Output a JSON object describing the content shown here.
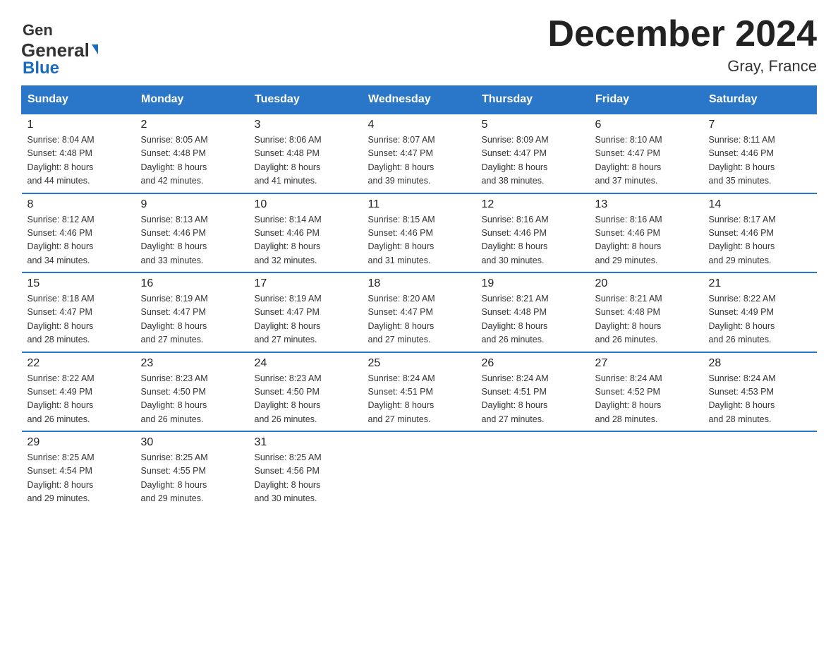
{
  "header": {
    "logo_general": "General",
    "logo_blue": "Blue",
    "title": "December 2024",
    "subtitle": "Gray, France"
  },
  "days_of_week": [
    "Sunday",
    "Monday",
    "Tuesday",
    "Wednesday",
    "Thursday",
    "Friday",
    "Saturday"
  ],
  "weeks": [
    [
      {
        "day": "1",
        "sunrise": "8:04 AM",
        "sunset": "4:48 PM",
        "daylight_hours": "8 hours",
        "daylight_minutes": "and 44 minutes."
      },
      {
        "day": "2",
        "sunrise": "8:05 AM",
        "sunset": "4:48 PM",
        "daylight_hours": "8 hours",
        "daylight_minutes": "and 42 minutes."
      },
      {
        "day": "3",
        "sunrise": "8:06 AM",
        "sunset": "4:48 PM",
        "daylight_hours": "8 hours",
        "daylight_minutes": "and 41 minutes."
      },
      {
        "day": "4",
        "sunrise": "8:07 AM",
        "sunset": "4:47 PM",
        "daylight_hours": "8 hours",
        "daylight_minutes": "and 39 minutes."
      },
      {
        "day": "5",
        "sunrise": "8:09 AM",
        "sunset": "4:47 PM",
        "daylight_hours": "8 hours",
        "daylight_minutes": "and 38 minutes."
      },
      {
        "day": "6",
        "sunrise": "8:10 AM",
        "sunset": "4:47 PM",
        "daylight_hours": "8 hours",
        "daylight_minutes": "and 37 minutes."
      },
      {
        "day": "7",
        "sunrise": "8:11 AM",
        "sunset": "4:46 PM",
        "daylight_hours": "8 hours",
        "daylight_minutes": "and 35 minutes."
      }
    ],
    [
      {
        "day": "8",
        "sunrise": "8:12 AM",
        "sunset": "4:46 PM",
        "daylight_hours": "8 hours",
        "daylight_minutes": "and 34 minutes."
      },
      {
        "day": "9",
        "sunrise": "8:13 AM",
        "sunset": "4:46 PM",
        "daylight_hours": "8 hours",
        "daylight_minutes": "and 33 minutes."
      },
      {
        "day": "10",
        "sunrise": "8:14 AM",
        "sunset": "4:46 PM",
        "daylight_hours": "8 hours",
        "daylight_minutes": "and 32 minutes."
      },
      {
        "day": "11",
        "sunrise": "8:15 AM",
        "sunset": "4:46 PM",
        "daylight_hours": "8 hours",
        "daylight_minutes": "and 31 minutes."
      },
      {
        "day": "12",
        "sunrise": "8:16 AM",
        "sunset": "4:46 PM",
        "daylight_hours": "8 hours",
        "daylight_minutes": "and 30 minutes."
      },
      {
        "day": "13",
        "sunrise": "8:16 AM",
        "sunset": "4:46 PM",
        "daylight_hours": "8 hours",
        "daylight_minutes": "and 29 minutes."
      },
      {
        "day": "14",
        "sunrise": "8:17 AM",
        "sunset": "4:46 PM",
        "daylight_hours": "8 hours",
        "daylight_minutes": "and 29 minutes."
      }
    ],
    [
      {
        "day": "15",
        "sunrise": "8:18 AM",
        "sunset": "4:47 PM",
        "daylight_hours": "8 hours",
        "daylight_minutes": "and 28 minutes."
      },
      {
        "day": "16",
        "sunrise": "8:19 AM",
        "sunset": "4:47 PM",
        "daylight_hours": "8 hours",
        "daylight_minutes": "and 27 minutes."
      },
      {
        "day": "17",
        "sunrise": "8:19 AM",
        "sunset": "4:47 PM",
        "daylight_hours": "8 hours",
        "daylight_minutes": "and 27 minutes."
      },
      {
        "day": "18",
        "sunrise": "8:20 AM",
        "sunset": "4:47 PM",
        "daylight_hours": "8 hours",
        "daylight_minutes": "and 27 minutes."
      },
      {
        "day": "19",
        "sunrise": "8:21 AM",
        "sunset": "4:48 PM",
        "daylight_hours": "8 hours",
        "daylight_minutes": "and 26 minutes."
      },
      {
        "day": "20",
        "sunrise": "8:21 AM",
        "sunset": "4:48 PM",
        "daylight_hours": "8 hours",
        "daylight_minutes": "and 26 minutes."
      },
      {
        "day": "21",
        "sunrise": "8:22 AM",
        "sunset": "4:49 PM",
        "daylight_hours": "8 hours",
        "daylight_minutes": "and 26 minutes."
      }
    ],
    [
      {
        "day": "22",
        "sunrise": "8:22 AM",
        "sunset": "4:49 PM",
        "daylight_hours": "8 hours",
        "daylight_minutes": "and 26 minutes."
      },
      {
        "day": "23",
        "sunrise": "8:23 AM",
        "sunset": "4:50 PM",
        "daylight_hours": "8 hours",
        "daylight_minutes": "and 26 minutes."
      },
      {
        "day": "24",
        "sunrise": "8:23 AM",
        "sunset": "4:50 PM",
        "daylight_hours": "8 hours",
        "daylight_minutes": "and 26 minutes."
      },
      {
        "day": "25",
        "sunrise": "8:24 AM",
        "sunset": "4:51 PM",
        "daylight_hours": "8 hours",
        "daylight_minutes": "and 27 minutes."
      },
      {
        "day": "26",
        "sunrise": "8:24 AM",
        "sunset": "4:51 PM",
        "daylight_hours": "8 hours",
        "daylight_minutes": "and 27 minutes."
      },
      {
        "day": "27",
        "sunrise": "8:24 AM",
        "sunset": "4:52 PM",
        "daylight_hours": "8 hours",
        "daylight_minutes": "and 28 minutes."
      },
      {
        "day": "28",
        "sunrise": "8:24 AM",
        "sunset": "4:53 PM",
        "daylight_hours": "8 hours",
        "daylight_minutes": "and 28 minutes."
      }
    ],
    [
      {
        "day": "29",
        "sunrise": "8:25 AM",
        "sunset": "4:54 PM",
        "daylight_hours": "8 hours",
        "daylight_minutes": "and 29 minutes."
      },
      {
        "day": "30",
        "sunrise": "8:25 AM",
        "sunset": "4:55 PM",
        "daylight_hours": "8 hours",
        "daylight_minutes": "and 29 minutes."
      },
      {
        "day": "31",
        "sunrise": "8:25 AM",
        "sunset": "4:56 PM",
        "daylight_hours": "8 hours",
        "daylight_minutes": "and 30 minutes."
      },
      null,
      null,
      null,
      null
    ]
  ]
}
